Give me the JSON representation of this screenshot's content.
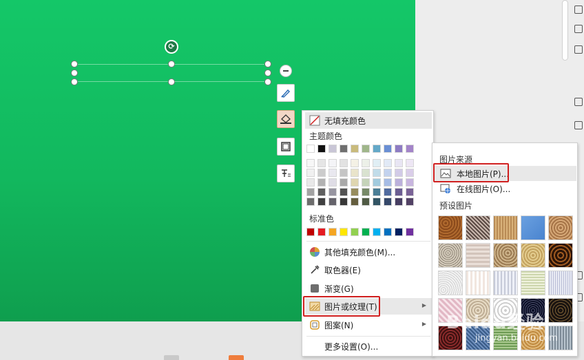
{
  "menu": {
    "no_fill": "无填充颜色",
    "theme_colors": "主题颜色",
    "standard_colors": "标准色",
    "more_fill_colors": "其他填充颜色(M)...",
    "eyedropper": "取色器(E)",
    "gradient": "渐变(G)",
    "picture_or_texture": "图片或纹理(T)",
    "pattern": "图案(N)",
    "more_settings": "更多设置(O)..."
  },
  "submenu": {
    "picture_source": "图片来源",
    "local_picture": "本地图片(P)...",
    "online_picture": "在线图片(O)...",
    "preset_pictures": "预设图片"
  },
  "theme_top_row": [
    "#ffffff",
    "#111111",
    "#c9c6d6",
    "#6f6f6f",
    "#c9bb7c",
    "#9fb68a",
    "#64a8c8",
    "#6a8fd4",
    "#8e7cc3",
    "#a384c9"
  ],
  "standard_row": [
    "#c00000",
    "#e51c23",
    "#f5a623",
    "#ffe600",
    "#92d050",
    "#00b050",
    "#00b0f0",
    "#0070c0",
    "#002060",
    "#7030a0"
  ],
  "watermark": {
    "brand": "Baidu经验",
    "url": "jingyan.baidu.com"
  },
  "colors": {
    "slide_green": "#13c066",
    "highlight_red": "#d01f1f"
  }
}
